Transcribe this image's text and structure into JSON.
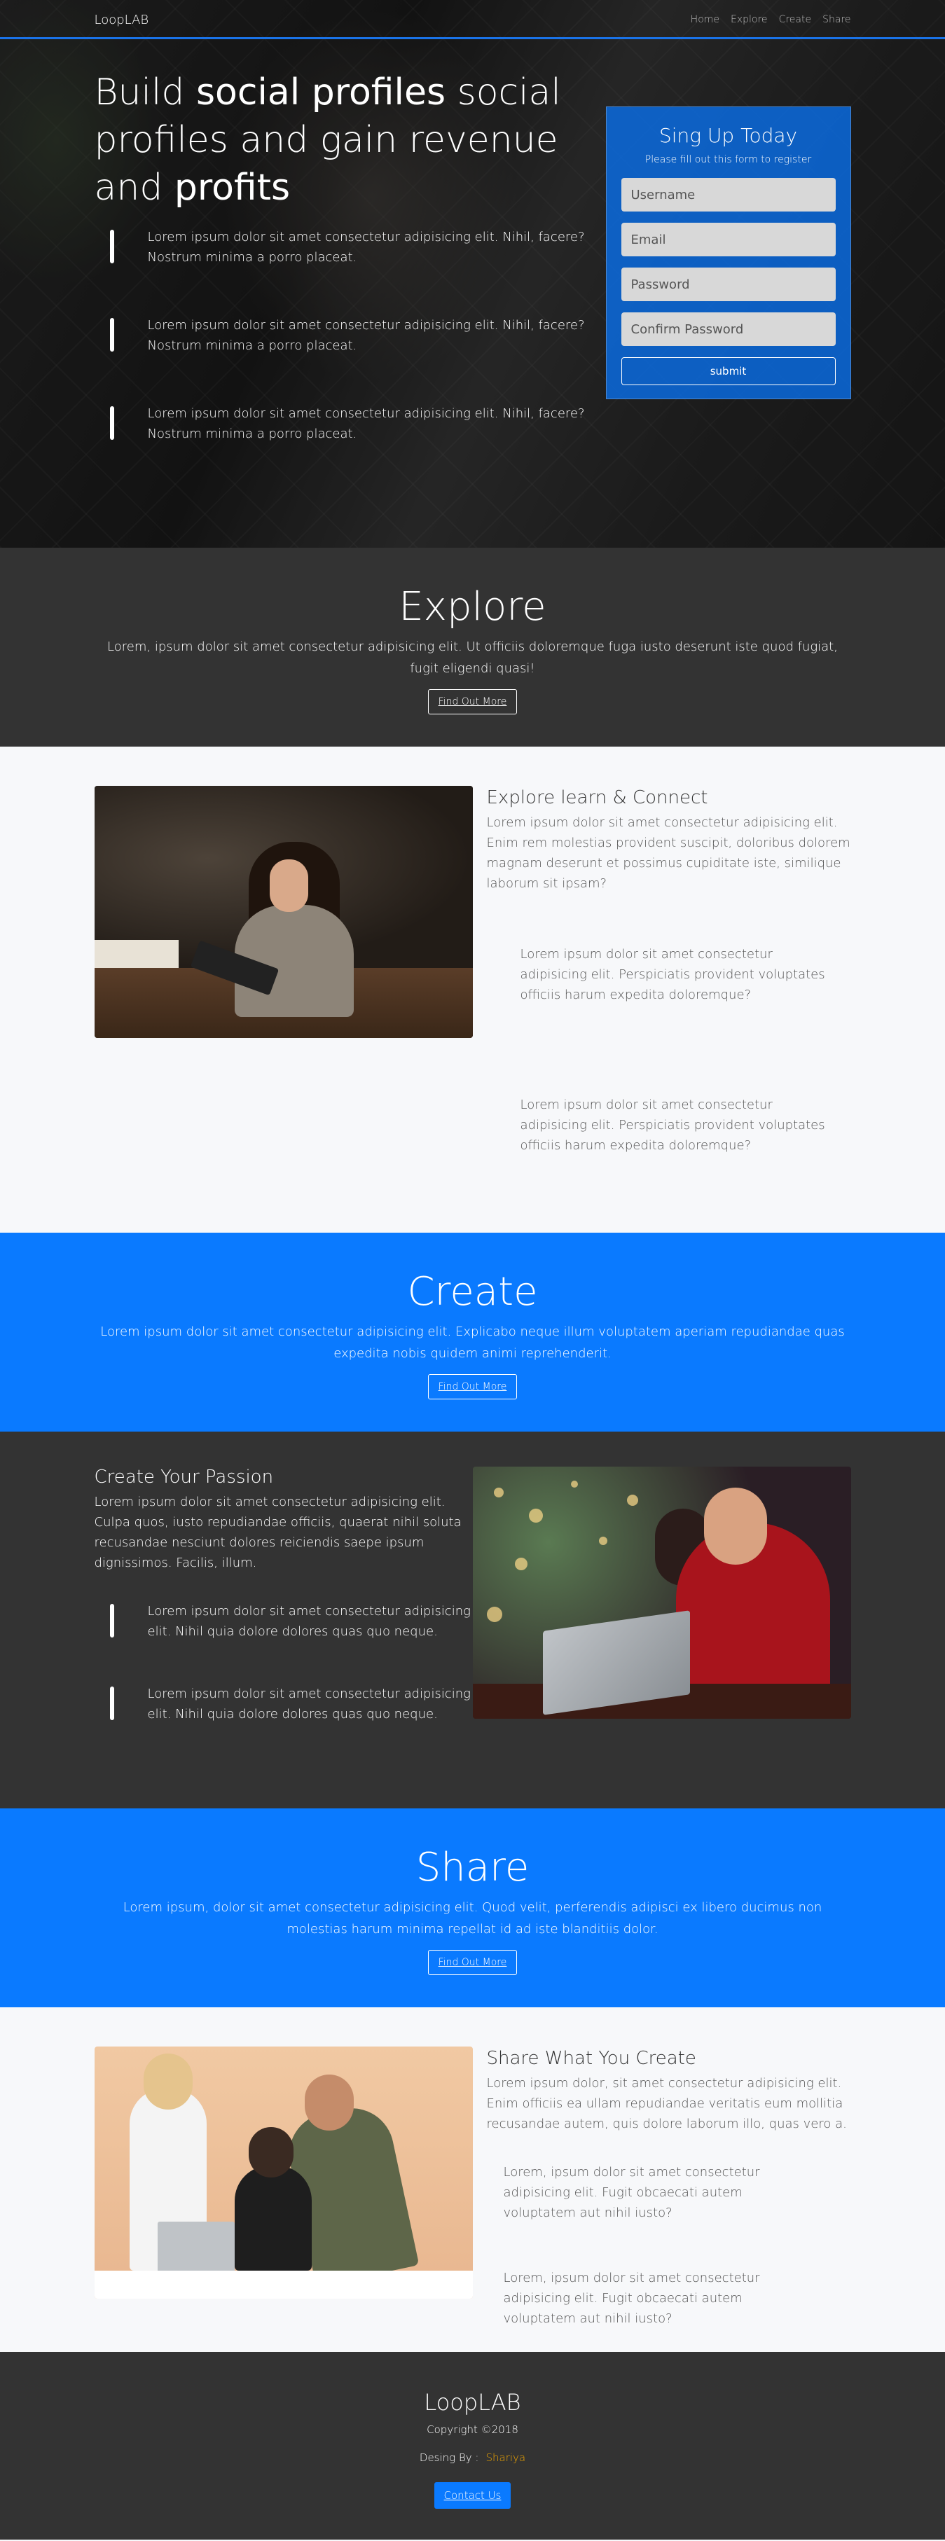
{
  "nav": {
    "brand": "LoopLAB",
    "links": [
      "Home",
      "Explore",
      "Create",
      "Share"
    ]
  },
  "hero": {
    "title_pre": "Build ",
    "title_bold1": "social profiles",
    "title_mid": " social profiles and gain revenue and ",
    "title_bold2": "profits",
    "items": [
      "Lorem ipsum dolor sit amet consectetur adipisicing elit. Nihil, facere? Nostrum minima a porro placeat.",
      "Lorem ipsum dolor sit amet consectetur adipisicing elit. Nihil, facere? Nostrum minima a porro placeat.",
      "Lorem ipsum dolor sit amet consectetur adipisicing elit. Nihil, facere? Nostrum minima a porro placeat."
    ]
  },
  "signup": {
    "title": "Sing Up Today",
    "subtitle": "Please fill out this form to register",
    "username_placeholder": "Username",
    "email_placeholder": "Email",
    "password_placeholder": "Password",
    "confirm_placeholder": "Confirm Password",
    "submit_label": "submit"
  },
  "explore": {
    "title": "Explore",
    "text": "Lorem, ipsum dolor sit amet consectetur adipisicing elit. Ut officiis doloremque fuga iusto deserunt iste quod fugiat, fugit eligendi quasi!",
    "button": "Find Out More"
  },
  "explore_feature": {
    "heading": "Explore learn & Connect",
    "lead": "Lorem ipsum dolor sit amet consectetur adipisicing elit. Enim rem molestias provident suscipit, doloribus dolorem magnam deserunt et possimus cupiditate iste, similique laborum sit ipsam?",
    "items": [
      "Lorem ipsum dolor sit amet consectetur adipisicing elit. Perspiciatis provident voluptates officiis harum expedita doloremque?",
      "Lorem ipsum dolor sit amet consectetur adipisicing elit. Perspiciatis provident voluptates officiis harum expedita doloremque?"
    ]
  },
  "create": {
    "title": "Create",
    "text": "Lorem ipsum dolor sit amet consectetur adipisicing elit. Explicabo neque illum voluptatem aperiam repudiandae quas expedita nobis quidem animi reprehenderit.",
    "button": "Find Out More"
  },
  "create_feature": {
    "heading": "Create Your Passion",
    "lead": "Lorem ipsum dolor sit amet consectetur adipisicing elit. Culpa quos, iusto repudiandae officiis, quaerat nihil soluta recusandae nesciunt dolores reiciendis saepe ipsum dignissimos. Facilis, illum.",
    "items": [
      "Lorem ipsum dolor sit amet consectetur adipisicing elit. Nihil quia dolore dolores quas quo neque.",
      "Lorem ipsum dolor sit amet consectetur adipisicing elit. Nihil quia dolore dolores quas quo neque."
    ]
  },
  "share": {
    "title": "Share",
    "text": "Lorem ipsum, dolor sit amet consectetur adipisicing elit. Quod velit, perferendis adipisci ex libero ducimus non molestias harum minima repellat id ad iste blanditiis dolor.",
    "button": "Find Out More"
  },
  "share_feature": {
    "heading": "Share What You Create",
    "lead": "Lorem ipsum dolor, sit amet consectetur adipisicing elit. Enim officiis ea ullam repudiandae veritatis eum mollitia recusandae autem, quis dolore laborum illo, quas vero a.",
    "items": [
      "Lorem, ipsum dolor sit amet consectetur adipisicing elit. Fugit obcaecati autem voluptatem aut nihil iusto?",
      "Lorem, ipsum dolor sit amet consectetur adipisicing elit. Fugit obcaecati autem voluptatem aut nihil iusto?"
    ]
  },
  "footer": {
    "brand": "LoopLAB",
    "copyright": "Copyright ©2018",
    "design_label": "Desing By :",
    "designer": "Shariya",
    "contact_button": "Contact Us"
  },
  "colors": {
    "accent_blue": "#0a7aff",
    "dark_bg": "#333333",
    "designer_name": "#f0a500"
  }
}
